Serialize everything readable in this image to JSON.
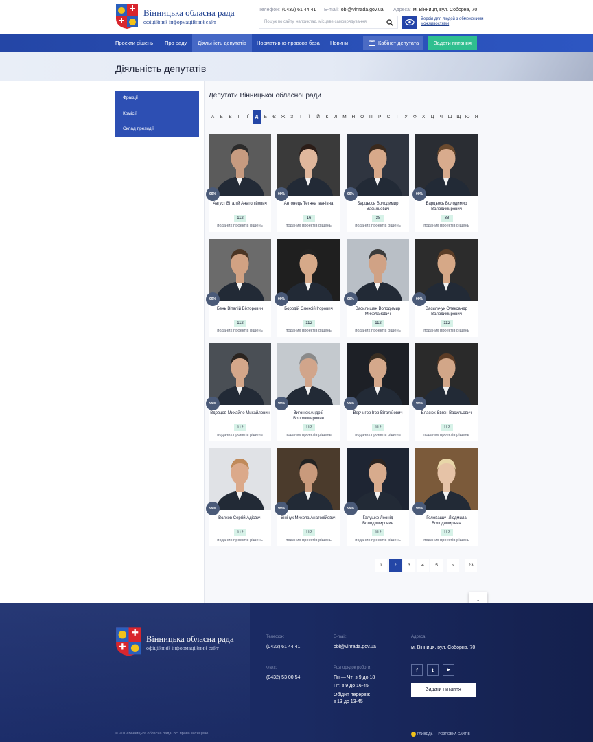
{
  "header": {
    "site_title": "Вінницька обласна рада",
    "site_subtitle": "офіційний інформаційний сайт",
    "phone_label": "Телефон:",
    "phone": "(0432) 61 44 41",
    "email_label": "E-mail:",
    "email": "obl@vinrada.gov.ua",
    "address_label": "Адреса:",
    "address": "м. Вінниця, вул. Соборна, 70",
    "search_placeholder": "Пошук по сайту, наприклад, місцеве самоврядування",
    "a11y_link": "Версія для людей з обмеженими можливостями"
  },
  "nav": {
    "items": [
      "Проекти рішень",
      "Про раду",
      "Діяльність депутатів",
      "Нормативно-правова база",
      "Новини"
    ],
    "cabinet": "Кабінет депутата",
    "ask": "Задати питання"
  },
  "page_title": "Діяльність депутатів",
  "sidebar": [
    "Фракції",
    "Комісії",
    "Склад президії"
  ],
  "section_title": "Депутати Вінницької обласної ради",
  "alphabet": [
    "А",
    "Б",
    "В",
    "Г",
    "Ґ",
    "Д",
    "Е",
    "Є",
    "Ж",
    "З",
    "І",
    "Ї",
    "Й",
    "К",
    "Л",
    "М",
    "Н",
    "О",
    "П",
    "Р",
    "С",
    "Т",
    "У",
    "Ф",
    "Х",
    "Ц",
    "Ч",
    "Ш",
    "Щ",
    "Ю",
    "Я"
  ],
  "active_letter": "Д",
  "card_label": "поданих проектів рішень",
  "deputies": [
    {
      "name": "Август Віталій Анатолійович",
      "percent": "99%",
      "count": "112"
    },
    {
      "name": "Антонець Тетяна Іванівна",
      "percent": "99%",
      "count": "16"
    },
    {
      "name": "Барцьось Володимир Васильович",
      "percent": "99%",
      "count": "38"
    },
    {
      "name": "Барцьось Володимир Володимирович",
      "percent": "99%",
      "count": "38"
    },
    {
      "name": "Бень Віталій Вікторович",
      "percent": "99%",
      "count": "112"
    },
    {
      "name": "Бородій Олексій Ігорович",
      "percent": "99%",
      "count": "112"
    },
    {
      "name": "Василишен Володимир Миколайович",
      "percent": "99%",
      "count": "112"
    },
    {
      "name": "Васильчук Олександр Володимирович",
      "percent": "99%",
      "count": "112"
    },
    {
      "name": "Вдовцов Михайло Михайлович",
      "percent": "99%",
      "count": "112"
    },
    {
      "name": "Вигонюк Андрій Володимирович",
      "percent": "99%",
      "count": "112"
    },
    {
      "name": "Верчигор Ігор Віталійович",
      "percent": "99%",
      "count": "112"
    },
    {
      "name": "Власюк Євген Васильович",
      "percent": "99%",
      "count": "112"
    },
    {
      "name": "Волков Сергій Адієвич",
      "percent": "99%",
      "count": "112"
    },
    {
      "name": "Вінічук Микола Анатолійович",
      "percent": "99%",
      "count": "112"
    },
    {
      "name": "Галушко Леонід Володимирович",
      "percent": "99%",
      "count": "112"
    },
    {
      "name": "Головашич Людмила Володимирівна",
      "percent": "99%",
      "count": "112"
    }
  ],
  "pagination": {
    "pages": [
      "1",
      "2",
      "3",
      "4",
      "5",
      "›",
      "23"
    ],
    "active": "2"
  },
  "to_top": "↑",
  "footer": {
    "title": "Вінницька обласна рада",
    "subtitle": "офіційний інформаційний сайт",
    "phone_label": "Телефон:",
    "phone": "(0432) 61 44 41",
    "email_label": "E-mail:",
    "email": "obl@vinrada.gov.ua",
    "address_label": "Адреса:",
    "address": "м. Вінниця, вул. Соборна, 70",
    "fax_label": "Факс:",
    "fax": "(0432) 53 00 54",
    "schedule_label": "Розпорядок роботи:",
    "schedule_1": "Пн — Чт: з 9 до 18",
    "schedule_2": "Пт: з 9 до 16-45",
    "lunch_1": "Обідня перерва:",
    "lunch_2": "з 13 до 13-45",
    "social": [
      "f",
      "t",
      "▶"
    ],
    "ask": "Задати питання",
    "copyright": "© 2019 Вінницька обласна рада. Всі права захищено",
    "developer": "ГЛИВЕДЬ — РОЗРОБКА САЙТІВ"
  },
  "colors": {
    "primary": "#2446a6",
    "accent_green": "#2fbf8f",
    "footer_bg": "#1a2a62"
  }
}
